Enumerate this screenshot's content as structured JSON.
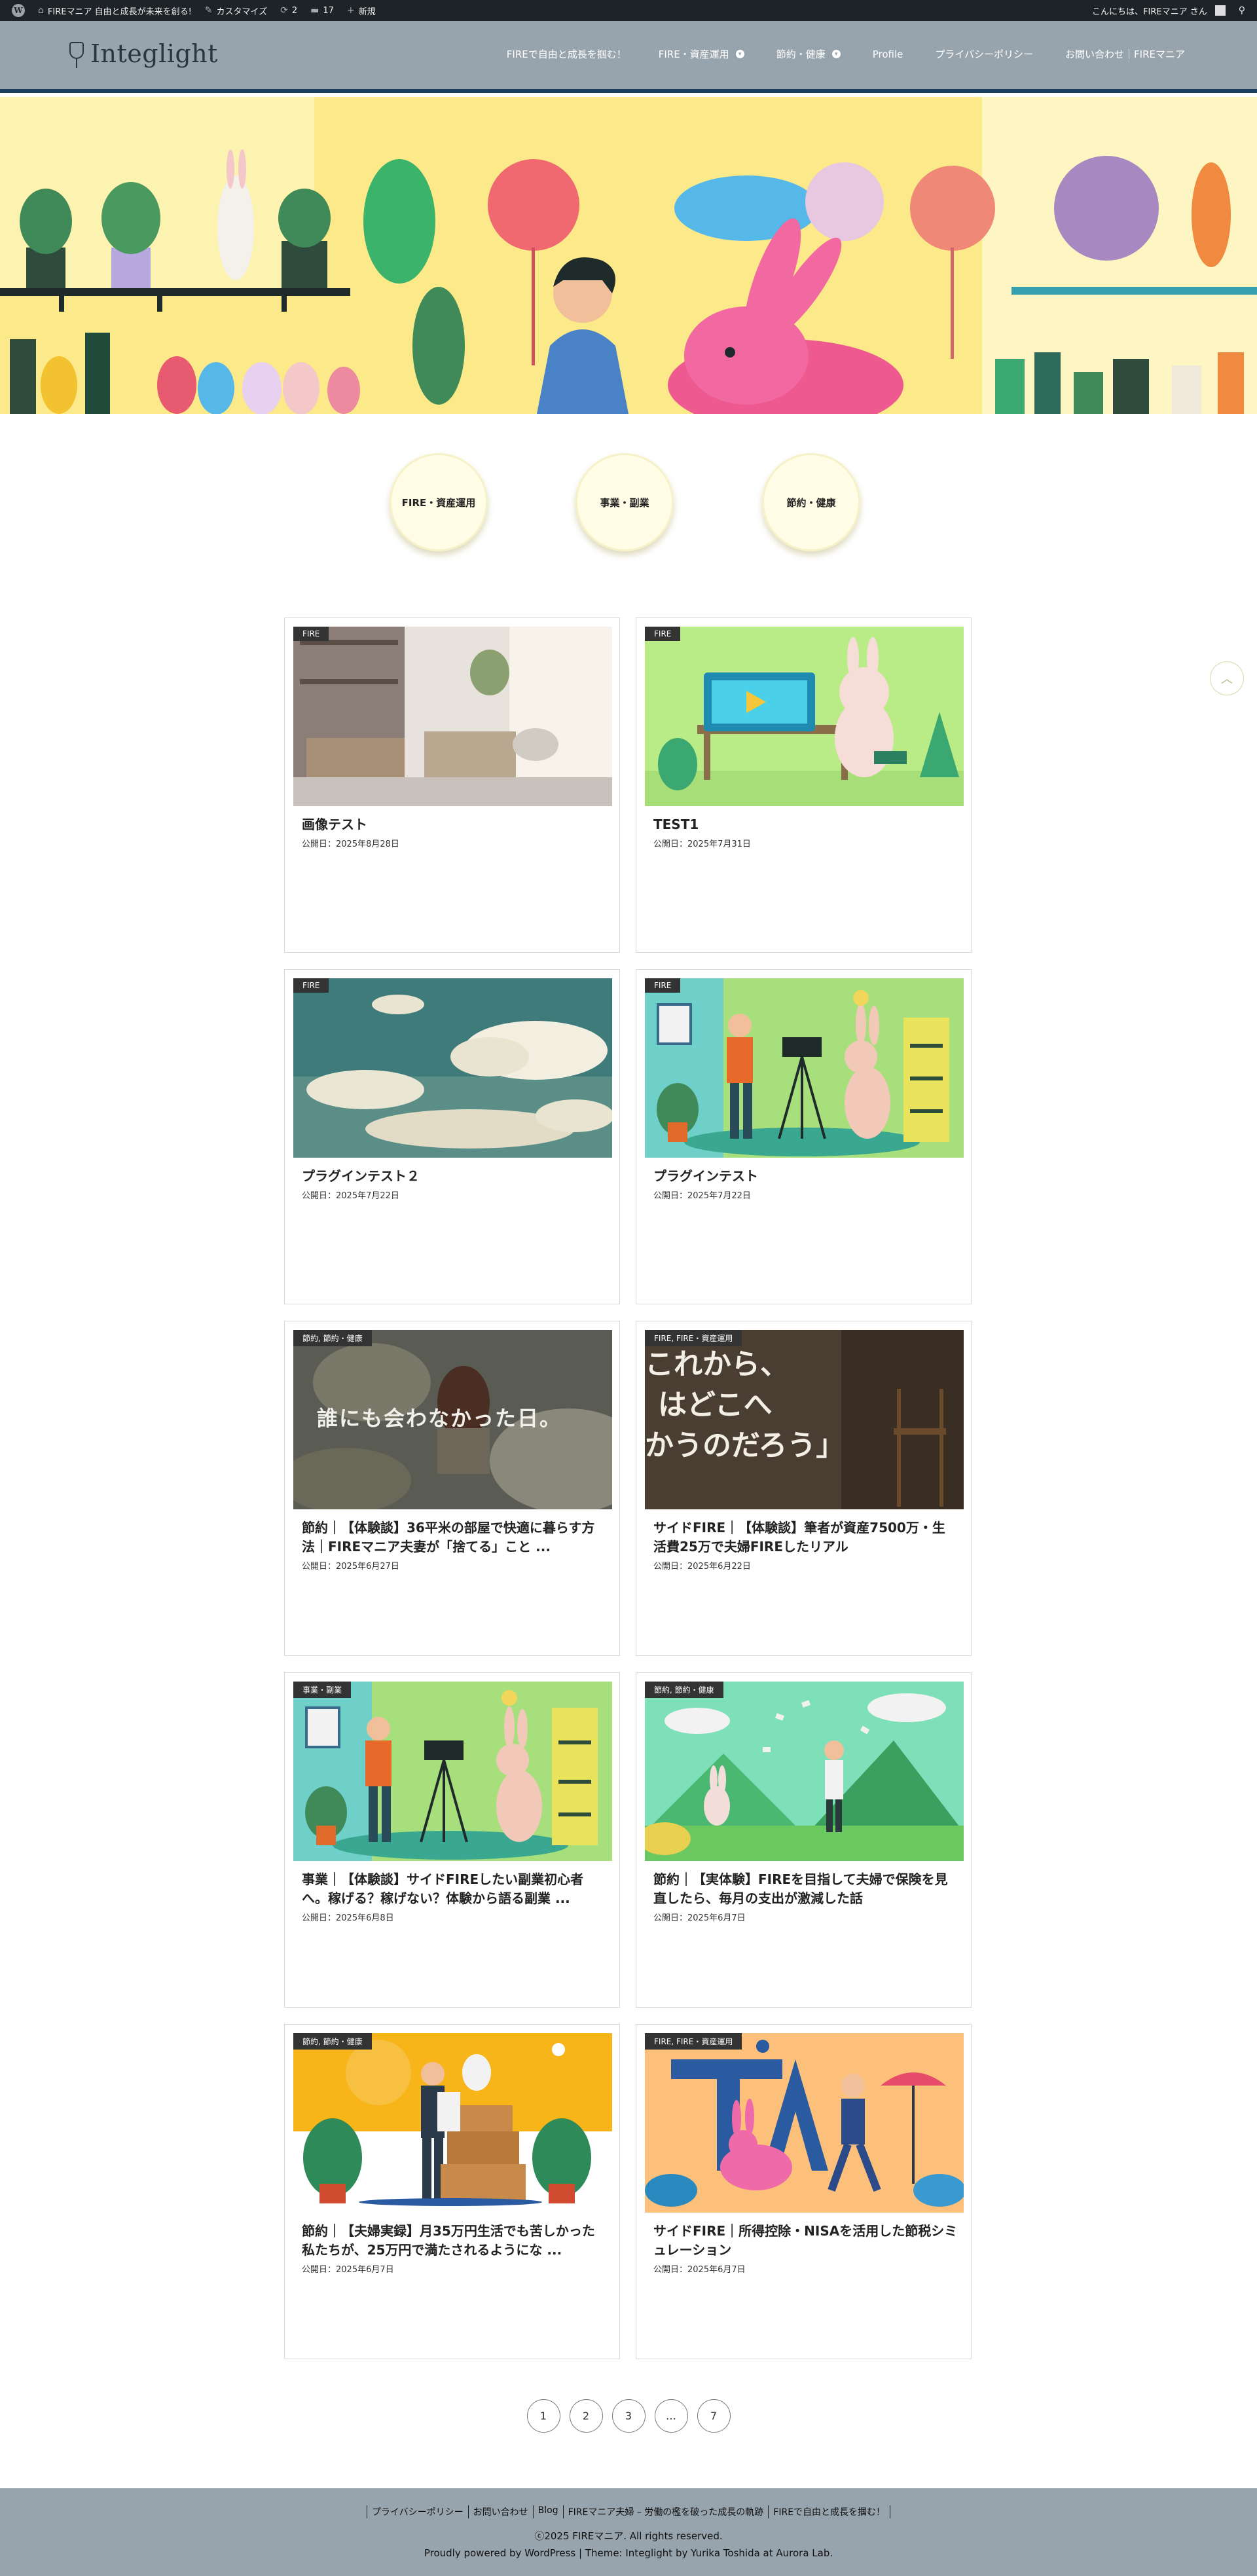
{
  "admin_bar": {
    "site_name": "FIREマニア 自由と成長が未来を創る!",
    "customize": "カスタマイズ",
    "updates": "2",
    "comments": "17",
    "new": "新規",
    "greeting": "こんにちは、FIREマニア さん"
  },
  "header": {
    "logo": "Integlight",
    "nav": [
      {
        "label": "FIREで自由と成長を掴む！"
      },
      {
        "label": "FIRE・資産運用"
      },
      {
        "label": "節約・健康"
      },
      {
        "label": "Profile"
      },
      {
        "label": "プライバシーポリシー"
      },
      {
        "label": "お問い合わせ｜FIREマニア"
      }
    ]
  },
  "categories": [
    {
      "label": "FIRE・資産運用"
    },
    {
      "label": "事業・副業"
    },
    {
      "label": "節約・健康"
    }
  ],
  "posts": [
    {
      "tag": "FIRE",
      "title": "画像テスト",
      "date": "公開日：2025年8月28日"
    },
    {
      "tag": "FIRE",
      "title": "TEST1",
      "date": "公開日：2025年7月31日"
    },
    {
      "tag": "FIRE",
      "title": "プラグインテスト２",
      "date": "公開日：2025年7月22日"
    },
    {
      "tag": "FIRE",
      "title": "プラグインテスト",
      "date": "公開日：2025年7月22日"
    },
    {
      "tag": "節約, 節約・健康",
      "title": "節約｜【体験談】36平米の部屋で快適に暮らす方法｜FIREマニア夫妻が「捨てる」こと ...",
      "date": "公開日：2025年6月27日"
    },
    {
      "tag": "FIRE, FIRE・資産運用",
      "title": "サイドFIRE｜【体験談】筆者が資産7500万・生活費25万で夫婦FIREしたリアル",
      "date": "公開日：2025年6月22日"
    },
    {
      "tag": "事業・副業",
      "title": "事業｜【体験談】サイドFIREしたい副業初心者へ。稼げる？稼げない？体験から語る副業 ...",
      "date": "公開日：2025年6月8日"
    },
    {
      "tag": "節約, 節約・健康",
      "title": "節約｜【実体験】FIREを目指して夫婦で保険を見直したら、毎月の支出が激減した話",
      "date": "公開日：2025年6月7日"
    },
    {
      "tag": "節約, 節約・健康",
      "title": "節約｜【夫婦実録】月35万円生活でも苦しかった私たちが、25万円で満たされるようにな ...",
      "date": "公開日：2025年6月7日"
    },
    {
      "tag": "FIRE, FIRE・資産運用",
      "title": "サイドFIRE｜所得控除・NISAを活用した節税シミュレーション",
      "date": "公開日：2025年6月7日"
    }
  ],
  "thumb_texts": {
    "post5": "誰にも会わなかった日。",
    "post6_lines": [
      "これから、",
      "はどこへ",
      "かうのだろう」"
    ]
  },
  "pagination": [
    "1",
    "2",
    "3",
    "…",
    "7"
  ],
  "footer": {
    "links": [
      "プライバシーポリシー",
      "お問い合わせ",
      "Blog",
      "FIREマニア夫婦 – 労働の檻を破った成長の軌跡",
      "FIREで自由と成長を掴む！"
    ],
    "copyright": "ⓒ2025 FIREマニア. All rights reserved.",
    "powered": "Proudly powered by WordPress | Theme: Integlight by Yurika Toshida at Aurora Lab."
  },
  "colors": {
    "header_bg": "#98a4ad",
    "header_border": "#1c3f5e",
    "admin_bg": "#1d2327"
  }
}
